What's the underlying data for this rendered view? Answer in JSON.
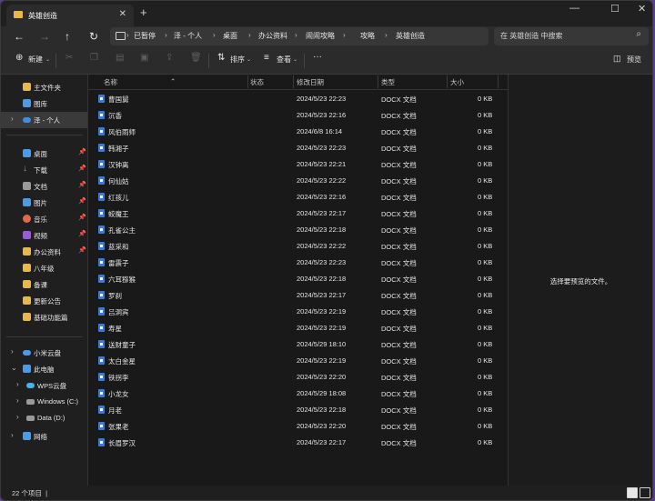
{
  "tab": {
    "title": "英雄创造",
    "close": "✕",
    "new": "+"
  },
  "window_controls": {
    "min": "—",
    "max": "☐",
    "close": "✕"
  },
  "nav": {
    "back": "←",
    "forward": "→",
    "up": "↑",
    "refresh": "↻"
  },
  "breadcrumb": [
    "已暂停",
    "泽 - 个人",
    "桌面",
    "办公资料",
    "闹闹攻略",
    "攻略",
    "英雄创造"
  ],
  "search": {
    "placeholder": "在 英雄创造 中搜索"
  },
  "toolbar": {
    "new_label": "新建",
    "sort_label": "排序",
    "view_label": "查看",
    "more_label": "···",
    "preview_label": "预览"
  },
  "sidebar": {
    "items": [
      {
        "label": "主文件夹",
        "icon": "home-icon",
        "color": "#e8b84a"
      },
      {
        "label": "图库",
        "icon": "gallery-icon",
        "color": "#4a9ce8"
      },
      {
        "label": "泽 - 个人",
        "icon": "onedrive-icon",
        "color": "#3b8fe0"
      },
      {
        "label": "桌面",
        "icon": "desktop-icon",
        "color": "#4a9ce8"
      },
      {
        "label": "下载",
        "icon": "download-icon",
        "color": "#4ac3a0"
      },
      {
        "label": "文档",
        "icon": "documents-icon",
        "color": "#9a9a9a"
      },
      {
        "label": "图片",
        "icon": "pictures-icon",
        "color": "#4a9ce8"
      },
      {
        "label": "音乐",
        "icon": "music-icon",
        "color": "#e06a4a"
      },
      {
        "label": "视频",
        "icon": "video-icon",
        "color": "#9a5ae0"
      },
      {
        "label": "办公资料",
        "icon": "folder-icon",
        "color": "#e8b84a"
      },
      {
        "label": "八年级",
        "icon": "folder-icon",
        "color": "#e8b84a"
      },
      {
        "label": "备课",
        "icon": "folder-icon",
        "color": "#e8b84a"
      },
      {
        "label": "更新公告",
        "icon": "folder-icon",
        "color": "#e8b84a"
      },
      {
        "label": "基础功能篇",
        "icon": "folder-icon",
        "color": "#e8b84a"
      },
      {
        "label": "小米云盘",
        "icon": "cloud-icon",
        "color": "#4a9ce8"
      },
      {
        "label": "此电脑",
        "icon": "pc-icon",
        "color": "#4a9ce8"
      },
      {
        "label": "WPS云盘",
        "icon": "cloud-icon",
        "color": "#4ab0e8"
      },
      {
        "label": "Windows (C:)",
        "icon": "drive-icon",
        "color": "#9a9a9a"
      },
      {
        "label": "Data (D:)",
        "icon": "drive-icon",
        "color": "#9a9a9a"
      },
      {
        "label": "网络",
        "icon": "network-icon",
        "color": "#4a9ce8"
      }
    ]
  },
  "columns": {
    "name": "名称",
    "status": "状态",
    "modified": "修改日期",
    "type": "类型",
    "size": "大小"
  },
  "files": [
    {
      "name": "曹国舅",
      "date": "2024/5/23 22:23",
      "type": "DOCX 文档",
      "size": "0 KB"
    },
    {
      "name": "沉香",
      "date": "2024/5/23 22:16",
      "type": "DOCX 文档",
      "size": "0 KB"
    },
    {
      "name": "风伯雨师",
      "date": "2024/6/8 16:14",
      "type": "DOCX 文档",
      "size": "0 KB"
    },
    {
      "name": "韩湘子",
      "date": "2024/5/23 22:23",
      "type": "DOCX 文档",
      "size": "0 KB"
    },
    {
      "name": "汉钟离",
      "date": "2024/5/23 22:21",
      "type": "DOCX 文档",
      "size": "0 KB"
    },
    {
      "name": "何仙姑",
      "date": "2024/5/23 22:22",
      "type": "DOCX 文档",
      "size": "0 KB"
    },
    {
      "name": "红孩儿",
      "date": "2024/5/23 22:16",
      "type": "DOCX 文档",
      "size": "0 KB"
    },
    {
      "name": "蛟魔王",
      "date": "2024/5/23 22:17",
      "type": "DOCX 文档",
      "size": "0 KB"
    },
    {
      "name": "孔雀公主",
      "date": "2024/5/23 22:18",
      "type": "DOCX 文档",
      "size": "0 KB"
    },
    {
      "name": "蓝采和",
      "date": "2024/5/23 22:22",
      "type": "DOCX 文档",
      "size": "0 KB"
    },
    {
      "name": "雷震子",
      "date": "2024/5/23 22:23",
      "type": "DOCX 文档",
      "size": "0 KB"
    },
    {
      "name": "六耳猕猴",
      "date": "2024/5/23 22:18",
      "type": "DOCX 文档",
      "size": "0 KB"
    },
    {
      "name": "罗刹",
      "date": "2024/5/23 22:17",
      "type": "DOCX 文档",
      "size": "0 KB"
    },
    {
      "name": "吕洞宾",
      "date": "2024/5/23 22:19",
      "type": "DOCX 文档",
      "size": "0 KB"
    },
    {
      "name": "寿星",
      "date": "2024/5/23 22:19",
      "type": "DOCX 文档",
      "size": "0 KB"
    },
    {
      "name": "送财童子",
      "date": "2024/5/29 18:10",
      "type": "DOCX 文档",
      "size": "0 KB"
    },
    {
      "name": "太白金星",
      "date": "2024/5/23 22:19",
      "type": "DOCX 文档",
      "size": "0 KB"
    },
    {
      "name": "铁拐李",
      "date": "2024/5/23 22:20",
      "type": "DOCX 文档",
      "size": "0 KB"
    },
    {
      "name": "小龙女",
      "date": "2024/5/29 18:08",
      "type": "DOCX 文档",
      "size": "0 KB"
    },
    {
      "name": "月老",
      "date": "2024/5/23 22:18",
      "type": "DOCX 文档",
      "size": "0 KB"
    },
    {
      "name": "张果老",
      "date": "2024/5/23 22:20",
      "type": "DOCX 文档",
      "size": "0 KB"
    },
    {
      "name": "长眉罗汉",
      "date": "2024/5/23 22:17",
      "type": "DOCX 文档",
      "size": "0 KB"
    }
  ],
  "preview": {
    "message": "选择要预览的文件。"
  },
  "status": {
    "count": "22 个项目",
    "cursor": "|"
  }
}
